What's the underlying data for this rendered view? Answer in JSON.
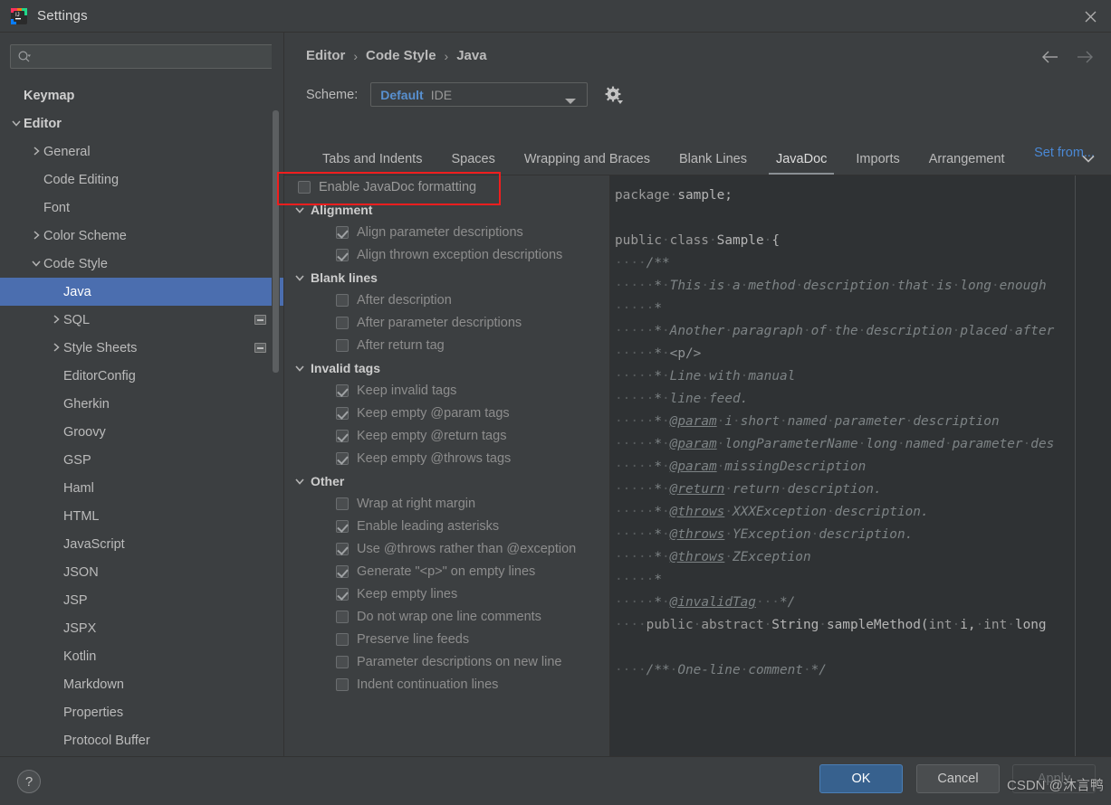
{
  "window": {
    "title": "Settings",
    "app_icon": "intellij-idea-icon",
    "close_icon": "close-icon"
  },
  "search": {
    "placeholder": "",
    "value": "",
    "icon": "search-icon"
  },
  "sidebar": {
    "items": [
      {
        "label": "Keymap",
        "indent": 0,
        "twisty": "none",
        "bold": true,
        "selected": false,
        "badge": false
      },
      {
        "label": "Editor",
        "indent": 0,
        "twisty": "expanded",
        "bold": true,
        "selected": false,
        "badge": false
      },
      {
        "label": "General",
        "indent": 1,
        "twisty": "collapsed",
        "bold": false,
        "selected": false,
        "badge": false
      },
      {
        "label": "Code Editing",
        "indent": 1,
        "twisty": "none",
        "bold": false,
        "selected": false,
        "badge": false
      },
      {
        "label": "Font",
        "indent": 1,
        "twisty": "none",
        "bold": false,
        "selected": false,
        "badge": false
      },
      {
        "label": "Color Scheme",
        "indent": 1,
        "twisty": "collapsed",
        "bold": false,
        "selected": false,
        "badge": false
      },
      {
        "label": "Code Style",
        "indent": 1,
        "twisty": "expanded",
        "bold": false,
        "selected": false,
        "badge": false
      },
      {
        "label": "Java",
        "indent": 2,
        "twisty": "none",
        "bold": false,
        "selected": true,
        "badge": false
      },
      {
        "label": "SQL",
        "indent": 2,
        "twisty": "collapsed",
        "bold": false,
        "selected": false,
        "badge": true
      },
      {
        "label": "Style Sheets",
        "indent": 2,
        "twisty": "collapsed",
        "bold": false,
        "selected": false,
        "badge": true
      },
      {
        "label": "EditorConfig",
        "indent": 2,
        "twisty": "none",
        "bold": false,
        "selected": false,
        "badge": false
      },
      {
        "label": "Gherkin",
        "indent": 2,
        "twisty": "none",
        "bold": false,
        "selected": false,
        "badge": false
      },
      {
        "label": "Groovy",
        "indent": 2,
        "twisty": "none",
        "bold": false,
        "selected": false,
        "badge": false
      },
      {
        "label": "GSP",
        "indent": 2,
        "twisty": "none",
        "bold": false,
        "selected": false,
        "badge": false
      },
      {
        "label": "Haml",
        "indent": 2,
        "twisty": "none",
        "bold": false,
        "selected": false,
        "badge": false
      },
      {
        "label": "HTML",
        "indent": 2,
        "twisty": "none",
        "bold": false,
        "selected": false,
        "badge": false
      },
      {
        "label": "JavaScript",
        "indent": 2,
        "twisty": "none",
        "bold": false,
        "selected": false,
        "badge": false
      },
      {
        "label": "JSON",
        "indent": 2,
        "twisty": "none",
        "bold": false,
        "selected": false,
        "badge": false
      },
      {
        "label": "JSP",
        "indent": 2,
        "twisty": "none",
        "bold": false,
        "selected": false,
        "badge": false
      },
      {
        "label": "JSPX",
        "indent": 2,
        "twisty": "none",
        "bold": false,
        "selected": false,
        "badge": false
      },
      {
        "label": "Kotlin",
        "indent": 2,
        "twisty": "none",
        "bold": false,
        "selected": false,
        "badge": false
      },
      {
        "label": "Markdown",
        "indent": 2,
        "twisty": "none",
        "bold": false,
        "selected": false,
        "badge": false
      },
      {
        "label": "Properties",
        "indent": 2,
        "twisty": "none",
        "bold": false,
        "selected": false,
        "badge": false
      },
      {
        "label": "Protocol Buffer",
        "indent": 2,
        "twisty": "none",
        "bold": false,
        "selected": false,
        "badge": false
      }
    ]
  },
  "header": {
    "breadcrumb": [
      "Editor",
      "Code Style",
      "Java"
    ],
    "breadcrumb_separator": "›",
    "back_icon": "arrow-left-icon",
    "forward_icon": "arrow-right-icon",
    "scheme_label": "Scheme:",
    "scheme_name": "Default",
    "scheme_kind": "IDE",
    "scheme_dropdown_icon": "chevron-down-icon",
    "gear_icon": "gear-icon",
    "set_from_link": "Set from..."
  },
  "tabs": {
    "items": [
      "Tabs and Indents",
      "Spaces",
      "Wrapping and Braces",
      "Blank Lines",
      "JavaDoc",
      "Imports",
      "Arrangement"
    ],
    "active": "JavaDoc",
    "overflow_icon": "chevron-down-icon"
  },
  "options": [
    {
      "kind": "checkbox",
      "label": "Enable JavaDoc formatting",
      "checked": false,
      "indent": 0,
      "highlighted": true
    },
    {
      "kind": "group",
      "label": "Alignment",
      "expanded": true
    },
    {
      "kind": "checkbox",
      "label": "Align parameter descriptions",
      "checked": true,
      "indent": 2
    },
    {
      "kind": "checkbox",
      "label": "Align thrown exception descriptions",
      "checked": true,
      "indent": 2
    },
    {
      "kind": "group",
      "label": "Blank lines",
      "expanded": true
    },
    {
      "kind": "checkbox",
      "label": "After description",
      "checked": false,
      "indent": 2
    },
    {
      "kind": "checkbox",
      "label": "After parameter descriptions",
      "checked": false,
      "indent": 2
    },
    {
      "kind": "checkbox",
      "label": "After return tag",
      "checked": false,
      "indent": 2
    },
    {
      "kind": "group",
      "label": "Invalid tags",
      "expanded": true
    },
    {
      "kind": "checkbox",
      "label": "Keep invalid tags",
      "checked": true,
      "indent": 2
    },
    {
      "kind": "checkbox",
      "label": "Keep empty @param tags",
      "checked": true,
      "indent": 2
    },
    {
      "kind": "checkbox",
      "label": "Keep empty @return tags",
      "checked": true,
      "indent": 2
    },
    {
      "kind": "checkbox",
      "label": "Keep empty @throws tags",
      "checked": true,
      "indent": 2
    },
    {
      "kind": "group",
      "label": "Other",
      "expanded": true
    },
    {
      "kind": "checkbox",
      "label": "Wrap at right margin",
      "checked": false,
      "indent": 2
    },
    {
      "kind": "checkbox",
      "label": "Enable leading asterisks",
      "checked": true,
      "indent": 2
    },
    {
      "kind": "checkbox",
      "label": "Use @throws rather than @exception",
      "checked": true,
      "indent": 2
    },
    {
      "kind": "checkbox",
      "label": "Generate \"<p>\" on empty lines",
      "checked": true,
      "indent": 2
    },
    {
      "kind": "checkbox",
      "label": "Keep empty lines",
      "checked": true,
      "indent": 2
    },
    {
      "kind": "checkbox",
      "label": "Do not wrap one line comments",
      "checked": false,
      "indent": 2
    },
    {
      "kind": "checkbox",
      "label": "Preserve line feeds",
      "checked": false,
      "indent": 2
    },
    {
      "kind": "checkbox",
      "label": "Parameter descriptions on new line",
      "checked": false,
      "indent": 2
    },
    {
      "kind": "checkbox",
      "label": "Indent continuation lines",
      "checked": false,
      "indent": 2
    }
  ],
  "preview": {
    "lines": [
      [
        {
          "t": "kw",
          "s": "package"
        },
        {
          "t": "ws",
          "s": "·"
        },
        {
          "t": "id",
          "s": "sample;"
        }
      ],
      [],
      [
        {
          "t": "kw",
          "s": "public"
        },
        {
          "t": "ws",
          "s": "·"
        },
        {
          "t": "kw",
          "s": "class"
        },
        {
          "t": "ws",
          "s": "·"
        },
        {
          "t": "id",
          "s": "Sample"
        },
        {
          "t": "ws",
          "s": "·"
        },
        {
          "t": "id",
          "s": "{"
        }
      ],
      [
        {
          "t": "ws",
          "s": "····"
        },
        {
          "t": "cm",
          "s": "/**"
        }
      ],
      [
        {
          "t": "ws",
          "s": "·····"
        },
        {
          "t": "cm",
          "s": "*"
        },
        {
          "t": "ws",
          "s": "·"
        },
        {
          "t": "cm",
          "s": "This"
        },
        {
          "t": "ws",
          "s": "·"
        },
        {
          "t": "cm",
          "s": "is"
        },
        {
          "t": "ws",
          "s": "·"
        },
        {
          "t": "cm",
          "s": "a"
        },
        {
          "t": "ws",
          "s": "·"
        },
        {
          "t": "cm",
          "s": "method"
        },
        {
          "t": "ws",
          "s": "·"
        },
        {
          "t": "cm",
          "s": "description"
        },
        {
          "t": "ws",
          "s": "·"
        },
        {
          "t": "cm",
          "s": "that"
        },
        {
          "t": "ws",
          "s": "·"
        },
        {
          "t": "cm",
          "s": "is"
        },
        {
          "t": "ws",
          "s": "·"
        },
        {
          "t": "cm",
          "s": "long"
        },
        {
          "t": "ws",
          "s": "·"
        },
        {
          "t": "cm",
          "s": "enough"
        }
      ],
      [
        {
          "t": "ws",
          "s": "·····"
        },
        {
          "t": "cm",
          "s": "*"
        }
      ],
      [
        {
          "t": "ws",
          "s": "·····"
        },
        {
          "t": "cm",
          "s": "*"
        },
        {
          "t": "ws",
          "s": "·"
        },
        {
          "t": "cm",
          "s": "Another"
        },
        {
          "t": "ws",
          "s": "·"
        },
        {
          "t": "cm",
          "s": "paragraph"
        },
        {
          "t": "ws",
          "s": "·"
        },
        {
          "t": "cm",
          "s": "of"
        },
        {
          "t": "ws",
          "s": "·"
        },
        {
          "t": "cm",
          "s": "the"
        },
        {
          "t": "ws",
          "s": "·"
        },
        {
          "t": "cm",
          "s": "description"
        },
        {
          "t": "ws",
          "s": "·"
        },
        {
          "t": "cm",
          "s": "placed"
        },
        {
          "t": "ws",
          "s": "·"
        },
        {
          "t": "cm",
          "s": "after"
        }
      ],
      [
        {
          "t": "ws",
          "s": "·····"
        },
        {
          "t": "cm",
          "s": "*"
        },
        {
          "t": "ws",
          "s": "·"
        },
        {
          "t": "html",
          "s": "<p/>"
        }
      ],
      [
        {
          "t": "ws",
          "s": "·····"
        },
        {
          "t": "cm",
          "s": "*"
        },
        {
          "t": "ws",
          "s": "·"
        },
        {
          "t": "cm",
          "s": "Line"
        },
        {
          "t": "ws",
          "s": "·"
        },
        {
          "t": "cm",
          "s": "with"
        },
        {
          "t": "ws",
          "s": "·"
        },
        {
          "t": "cm",
          "s": "manual"
        }
      ],
      [
        {
          "t": "ws",
          "s": "·····"
        },
        {
          "t": "cm",
          "s": "*"
        },
        {
          "t": "ws",
          "s": "·"
        },
        {
          "t": "cm",
          "s": "line"
        },
        {
          "t": "ws",
          "s": "·"
        },
        {
          "t": "cm",
          "s": "feed."
        }
      ],
      [
        {
          "t": "ws",
          "s": "·····"
        },
        {
          "t": "cm",
          "s": "*"
        },
        {
          "t": "ws",
          "s": "·"
        },
        {
          "t": "tag",
          "s": "@param"
        },
        {
          "t": "ws",
          "s": "·"
        },
        {
          "t": "cm",
          "s": "i"
        },
        {
          "t": "ws",
          "s": "·"
        },
        {
          "t": "cm",
          "s": "short"
        },
        {
          "t": "ws",
          "s": "·"
        },
        {
          "t": "cm",
          "s": "named"
        },
        {
          "t": "ws",
          "s": "·"
        },
        {
          "t": "cm",
          "s": "parameter"
        },
        {
          "t": "ws",
          "s": "·"
        },
        {
          "t": "cm",
          "s": "description"
        }
      ],
      [
        {
          "t": "ws",
          "s": "·····"
        },
        {
          "t": "cm",
          "s": "*"
        },
        {
          "t": "ws",
          "s": "·"
        },
        {
          "t": "tag",
          "s": "@param"
        },
        {
          "t": "ws",
          "s": "·"
        },
        {
          "t": "cm",
          "s": "longParameterName"
        },
        {
          "t": "ws",
          "s": "·"
        },
        {
          "t": "cm",
          "s": "long"
        },
        {
          "t": "ws",
          "s": "·"
        },
        {
          "t": "cm",
          "s": "named"
        },
        {
          "t": "ws",
          "s": "·"
        },
        {
          "t": "cm",
          "s": "parameter"
        },
        {
          "t": "ws",
          "s": "·"
        },
        {
          "t": "cm",
          "s": "des"
        }
      ],
      [
        {
          "t": "ws",
          "s": "·····"
        },
        {
          "t": "cm",
          "s": "*"
        },
        {
          "t": "ws",
          "s": "·"
        },
        {
          "t": "tag",
          "s": "@param"
        },
        {
          "t": "ws",
          "s": "·"
        },
        {
          "t": "cm",
          "s": "missingDescription"
        }
      ],
      [
        {
          "t": "ws",
          "s": "·····"
        },
        {
          "t": "cm",
          "s": "*"
        },
        {
          "t": "ws",
          "s": "·"
        },
        {
          "t": "tag",
          "s": "@return"
        },
        {
          "t": "ws",
          "s": "·"
        },
        {
          "t": "cm",
          "s": "return"
        },
        {
          "t": "ws",
          "s": "·"
        },
        {
          "t": "cm",
          "s": "description."
        }
      ],
      [
        {
          "t": "ws",
          "s": "·····"
        },
        {
          "t": "cm",
          "s": "*"
        },
        {
          "t": "ws",
          "s": "·"
        },
        {
          "t": "tag",
          "s": "@throws"
        },
        {
          "t": "ws",
          "s": "·"
        },
        {
          "t": "cm",
          "s": "XXXException"
        },
        {
          "t": "ws",
          "s": "·"
        },
        {
          "t": "cm",
          "s": "description."
        }
      ],
      [
        {
          "t": "ws",
          "s": "·····"
        },
        {
          "t": "cm",
          "s": "*"
        },
        {
          "t": "ws",
          "s": "·"
        },
        {
          "t": "tag",
          "s": "@throws"
        },
        {
          "t": "ws",
          "s": "·"
        },
        {
          "t": "cm",
          "s": "YException"
        },
        {
          "t": "ws",
          "s": "·"
        },
        {
          "t": "cm",
          "s": "description."
        }
      ],
      [
        {
          "t": "ws",
          "s": "·····"
        },
        {
          "t": "cm",
          "s": "*"
        },
        {
          "t": "ws",
          "s": "·"
        },
        {
          "t": "tag",
          "s": "@throws"
        },
        {
          "t": "ws",
          "s": "·"
        },
        {
          "t": "cm",
          "s": "ZException"
        }
      ],
      [
        {
          "t": "ws",
          "s": "·····"
        },
        {
          "t": "cm",
          "s": "*"
        }
      ],
      [
        {
          "t": "ws",
          "s": "·····"
        },
        {
          "t": "cm",
          "s": "*"
        },
        {
          "t": "ws",
          "s": "·"
        },
        {
          "t": "tag",
          "s": "@invalidTag"
        },
        {
          "t": "ws",
          "s": "···"
        },
        {
          "t": "cm",
          "s": "*/"
        }
      ],
      [
        {
          "t": "ws",
          "s": "····"
        },
        {
          "t": "kw",
          "s": "public"
        },
        {
          "t": "ws",
          "s": "·"
        },
        {
          "t": "kw",
          "s": "abstract"
        },
        {
          "t": "ws",
          "s": "·"
        },
        {
          "t": "id",
          "s": "String"
        },
        {
          "t": "ws",
          "s": "·"
        },
        {
          "t": "id",
          "s": "sampleMethod("
        },
        {
          "t": "kw",
          "s": "int"
        },
        {
          "t": "ws",
          "s": "·"
        },
        {
          "t": "id",
          "s": "i,"
        },
        {
          "t": "ws",
          "s": "·"
        },
        {
          "t": "kw",
          "s": "int"
        },
        {
          "t": "ws",
          "s": "·"
        },
        {
          "t": "id",
          "s": "long"
        }
      ],
      [],
      [
        {
          "t": "ws",
          "s": "····"
        },
        {
          "t": "cm",
          "s": "/**"
        },
        {
          "t": "ws",
          "s": "·"
        },
        {
          "t": "cm",
          "s": "One-line"
        },
        {
          "t": "ws",
          "s": "·"
        },
        {
          "t": "cm",
          "s": "comment"
        },
        {
          "t": "ws",
          "s": "·"
        },
        {
          "t": "cm",
          "s": "*/"
        }
      ]
    ]
  },
  "footer": {
    "help_label": "?",
    "ok_label": "OK",
    "cancel_label": "Cancel",
    "apply_label": "Apply",
    "watermark": "CSDN @沐言鸭"
  }
}
